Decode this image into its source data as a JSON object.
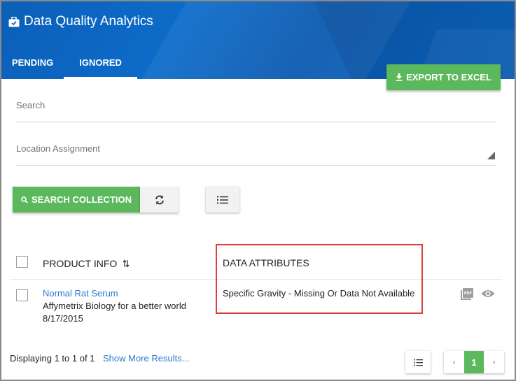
{
  "app": {
    "title": "Data Quality Analytics",
    "icon": "briefcase-icon"
  },
  "tabs": [
    {
      "label": "PENDING",
      "active": false
    },
    {
      "label": "IGNORED",
      "active": true
    }
  ],
  "toolbar": {
    "export_label": "EXPORT TO EXCEL",
    "search_collection_label": "SEARCH COLLECTION"
  },
  "filters": {
    "search_label": "Search",
    "location_label": "Location Assignment"
  },
  "table": {
    "columns": [
      "PRODUCT INFO",
      "DATA ATTRIBUTES"
    ],
    "rows": [
      {
        "product_name": "Normal Rat Serum",
        "vendor": "Affymetrix Biology for a better world",
        "date": "8/17/2015",
        "attribute": "Specific Gravity - Missing Or Data Not Available"
      }
    ]
  },
  "footer": {
    "display_text": "Displaying 1 to 1 of 1",
    "show_more": "Show More Results...",
    "current_page": "1",
    "prev": "‹",
    "next": "›"
  },
  "colors": {
    "header_blue": "#0b5fb8",
    "accent_green": "#5cb85c",
    "link_blue": "#2b7bd0",
    "highlight_red": "#e03c3c"
  }
}
